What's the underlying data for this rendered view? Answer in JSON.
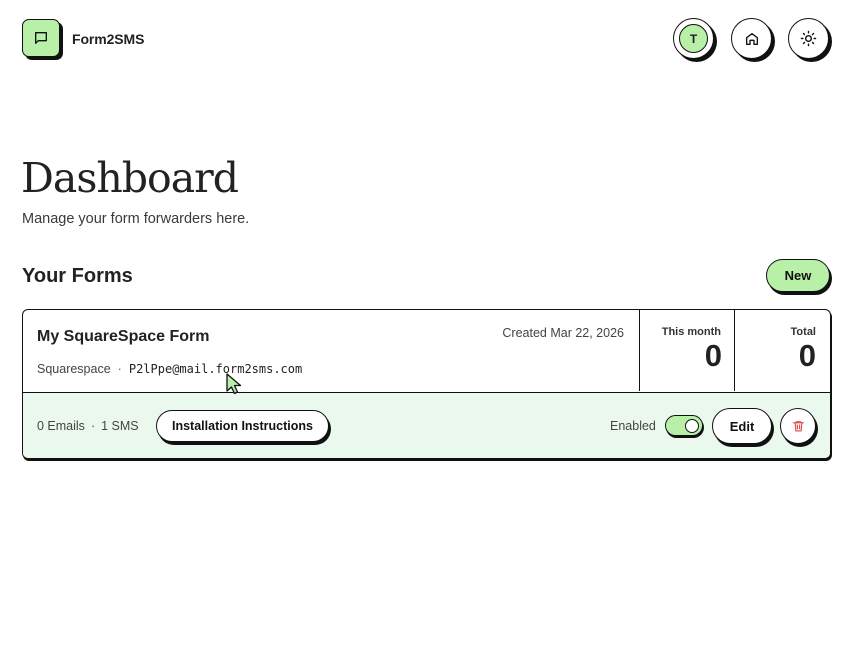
{
  "header": {
    "brand": "Form2SMS",
    "avatar_initial": "T",
    "icons": {
      "logo": "message-square-icon",
      "home": "home-icon",
      "theme": "sun-icon"
    }
  },
  "page": {
    "title": "Dashboard",
    "subtitle": "Manage your form forwarders here."
  },
  "forms_section": {
    "title": "Your Forms",
    "new_label": "New"
  },
  "forms": [
    {
      "name": "My SquareSpace Form",
      "created": "Created Mar 22, 2026",
      "platform": "Squarespace",
      "separator": "·",
      "email": "P2lPpe@mail.form2sms.com",
      "stats": {
        "month_label": "This month",
        "month_value": "0",
        "total_label": "Total",
        "total_value": "0"
      },
      "emails_count": "0 Emails",
      "sms_count": "1 SMS",
      "install_label": "Installation Instructions",
      "enabled_label": "Enabled",
      "enabled": true,
      "edit_label": "Edit"
    }
  ],
  "colors": {
    "accent": "#b8f0a8",
    "card_footer_bg": "#ebf8ee",
    "border": "#111111",
    "danger": "#e05252"
  }
}
